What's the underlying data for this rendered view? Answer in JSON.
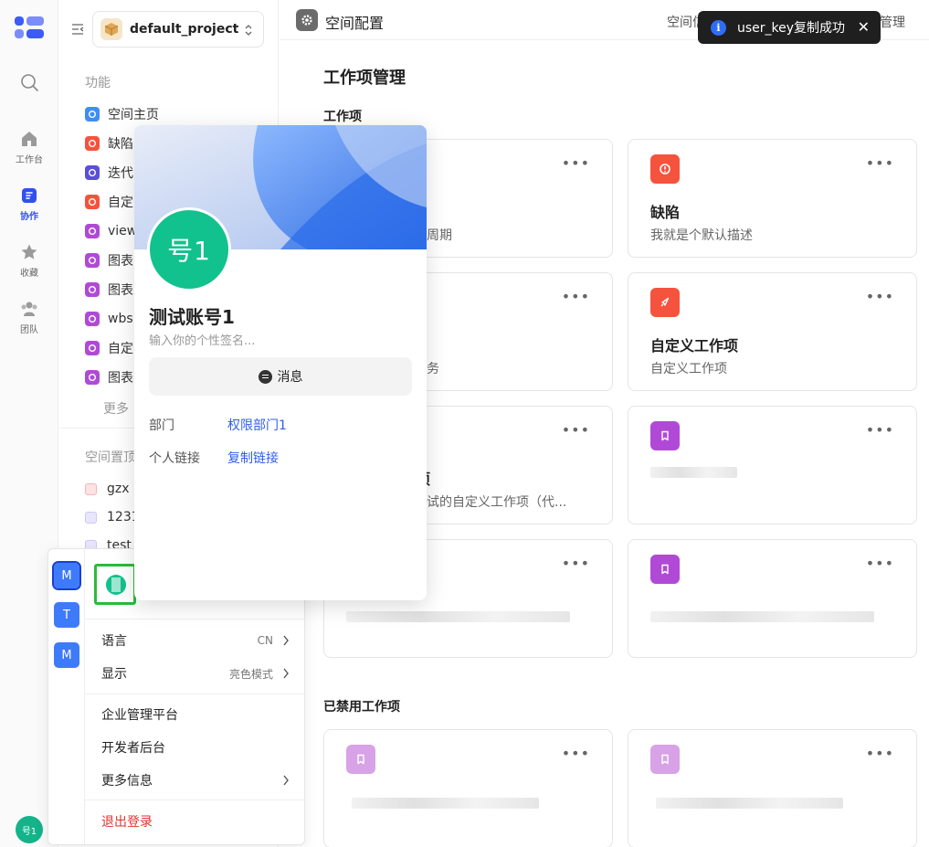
{
  "rail": {
    "items": [
      {
        "label": "工作台",
        "icon": "home-icon"
      },
      {
        "label": "协作",
        "icon": "collab-icon"
      },
      {
        "label": "收藏",
        "icon": "star-icon"
      },
      {
        "label": "团队",
        "icon": "team-icon"
      }
    ],
    "avatar_text": "号1"
  },
  "sidebar": {
    "project_name": "default_project",
    "section_features": "功能",
    "items": [
      {
        "label": "空间主页",
        "color": "#3e8ef7"
      },
      {
        "label": "缺陷",
        "color": "#f5533d"
      },
      {
        "label": "迭代",
        "color": "#5b4fd9"
      },
      {
        "label": "自定",
        "color": "#f5533d"
      },
      {
        "label": "view",
        "color": "#b04ad6"
      },
      {
        "label": "图表",
        "color": "#b04ad6"
      },
      {
        "label": "图表",
        "color": "#b04ad6"
      },
      {
        "label": "wbs",
        "color": "#b04ad6"
      },
      {
        "label": "自定",
        "color": "#b04ad6"
      },
      {
        "label": "图表",
        "color": "#b04ad6"
      }
    ],
    "more_label": "更多",
    "section_pinned": "空间置顶",
    "pinned": [
      {
        "label": "gzx",
        "color": "#fde3e3"
      },
      {
        "label": "12312",
        "color": "#e8e6fb"
      },
      {
        "label": "test",
        "color": "#e8e6fb"
      }
    ]
  },
  "topbar": {
    "title": "空间配置",
    "tab_left": "空间信",
    "tab_right": "管理"
  },
  "main": {
    "heading": "工作项管理",
    "section_active": "工作项",
    "section_disabled": "已禁用工作项",
    "cards": [
      {
        "title": "",
        "desc": "生命周期",
        "icon_color": "#3e8ef7"
      },
      {
        "title": "缺陷",
        "desc": "我就是个默认描述",
        "icon_color": "#f5533d"
      },
      {
        "title": "",
        "desc": "子任务",
        "icon_color": "#5b4fd9"
      },
      {
        "title": "自定义工作项",
        "desc": "自定义工作项",
        "icon_color": "#f5533d"
      },
      {
        "title": "作项",
        "desc": "限测试的自定义工作项（代...",
        "icon_color": "#b04ad6"
      },
      {
        "title": "",
        "desc": "",
        "icon_color": "#b04ad6"
      },
      {
        "title": "",
        "desc": "",
        "icon_color": "#b04ad6"
      },
      {
        "title": "",
        "desc": "",
        "icon_color": "#b04ad6"
      }
    ],
    "disabled_cards": [
      {
        "icon_color": "#d8a3e6"
      },
      {
        "icon_color": "#d8a3e6"
      }
    ],
    "more_glyph": "•••"
  },
  "toast": {
    "icon": "i",
    "message": "user_key复制成功",
    "close": "✕"
  },
  "account_menu": {
    "workspaces": [
      "M",
      "T",
      "M"
    ],
    "rows": [
      {
        "label": "语言",
        "value": "CN",
        "chevron": true
      },
      {
        "label": "显示",
        "value": "亮色模式",
        "chevron": true
      },
      {
        "label": "企业管理平台",
        "value": "",
        "chevron": false
      },
      {
        "label": "开发者后台",
        "value": "",
        "chevron": false
      },
      {
        "label": "更多信息",
        "value": "",
        "chevron": true
      },
      {
        "label": "退出登录",
        "value": "",
        "chevron": false
      }
    ]
  },
  "profile": {
    "avatar_text": "号1",
    "name": "测试账号1",
    "signature_placeholder": "输入你的个性签名...",
    "message_button": "消息",
    "dept_label": "部门",
    "dept_value": "权限部门1",
    "link_label": "个人链接",
    "link_value": "复制链接"
  }
}
